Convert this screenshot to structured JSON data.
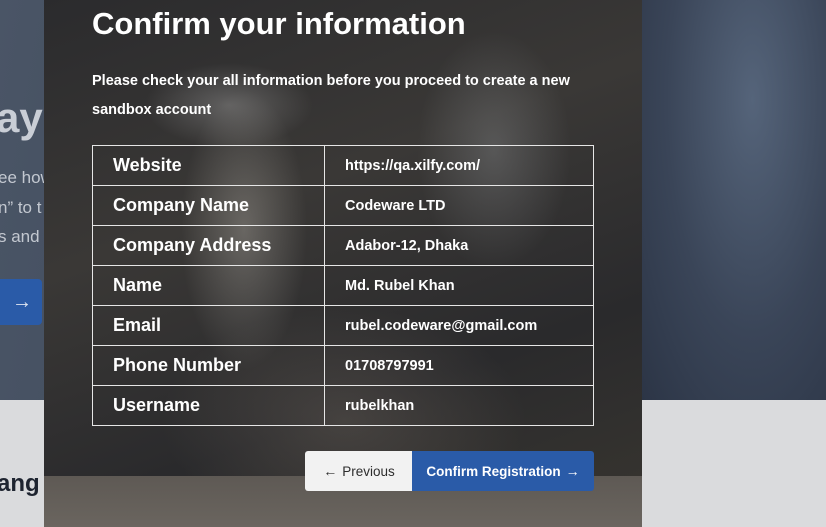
{
  "background": {
    "heading_fragment": "ay",
    "text_lines": [
      "ee how",
      "n” to t",
      "s and"
    ],
    "arrow_glyph": "→",
    "subheading_fragment": "ang"
  },
  "modal": {
    "title": "Confirm your information",
    "description": "Please check your all information before you proceed to create a new sandbox account",
    "rows": [
      {
        "label": "Website",
        "value": "https://qa.xilfy.com/"
      },
      {
        "label": "Company Name",
        "value": "Codeware LTD"
      },
      {
        "label": "Company Address",
        "value": "Adabor-12, Dhaka"
      },
      {
        "label": "Name",
        "value": "Md. Rubel Khan"
      },
      {
        "label": "Email",
        "value": "rubel.codeware@gmail.com"
      },
      {
        "label": "Phone Number",
        "value": "01708797991"
      },
      {
        "label": "Username",
        "value": "rubelkhan"
      }
    ],
    "previous_label": "Previous",
    "confirm_label": "Confirm Registration",
    "left_arrow_icon": "←",
    "right_arrow_icon": "→"
  },
  "colors": {
    "accent": "#2a5ba8",
    "modal_background": "#1c1d20",
    "previous_button": "#f2f2f2"
  }
}
